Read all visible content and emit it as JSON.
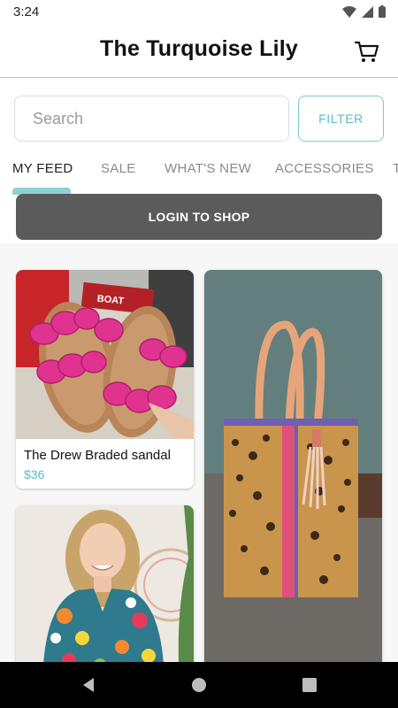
{
  "status_bar": {
    "time": "3:24"
  },
  "header": {
    "title": "The Turquoise Lily"
  },
  "search": {
    "placeholder": "Search",
    "filter_label": "FILTER"
  },
  "tabs": [
    {
      "label": "MY FEED",
      "active": true
    },
    {
      "label": "SALE"
    },
    {
      "label": "WHAT'S NEW"
    },
    {
      "label": "ACCESSORIES"
    },
    {
      "label": "T"
    }
  ],
  "login_banner": {
    "label": "LOGIN TO SHOP"
  },
  "feed": {
    "cards": [
      {
        "title": "The Drew Braded sandal",
        "price": "$36",
        "image": "pink-braided-sandals"
      },
      {
        "image": "leopard-tote-bag"
      },
      {
        "image": "floral-top-model"
      }
    ]
  },
  "colors": {
    "accent": "#5bbcc4",
    "banner": "#5b5b5b",
    "sandal": "#e0338f",
    "navbar": "#000000"
  }
}
